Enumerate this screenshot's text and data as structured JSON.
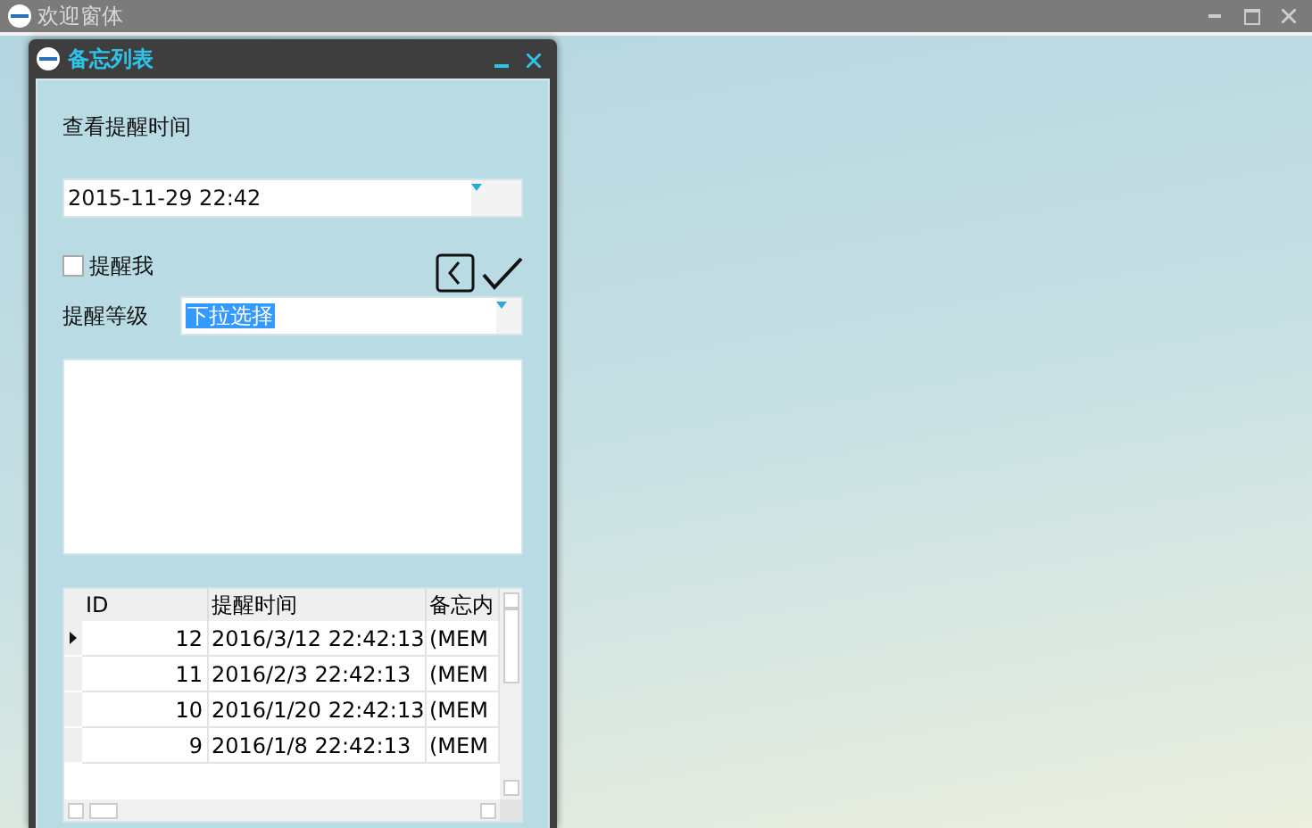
{
  "main_window": {
    "title": "欢迎窗体"
  },
  "dialog": {
    "title": "备忘列表"
  },
  "reminder_time": {
    "label": "查看提醒时间",
    "value": "2015-11-29 22:42"
  },
  "remind_me": {
    "label": "提醒我",
    "checked": false
  },
  "level": {
    "label": "提醒等级",
    "value": "下拉选择"
  },
  "grid": {
    "columns": [
      "ID",
      "提醒时间",
      "备忘内"
    ],
    "rows": [
      {
        "id": "12",
        "time": "2016/3/12 22:42:13",
        "memo": "(MEM",
        "selected": true
      },
      {
        "id": "11",
        "time": "2016/2/3 22:42:13",
        "memo": "(MEM",
        "selected": false
      },
      {
        "id": "10",
        "time": "2016/1/20 22:42:13",
        "memo": "(MEM",
        "selected": false
      },
      {
        "id": "9",
        "time": "2016/1/8 22:42:13",
        "memo": "(MEM",
        "selected": false
      }
    ]
  }
}
